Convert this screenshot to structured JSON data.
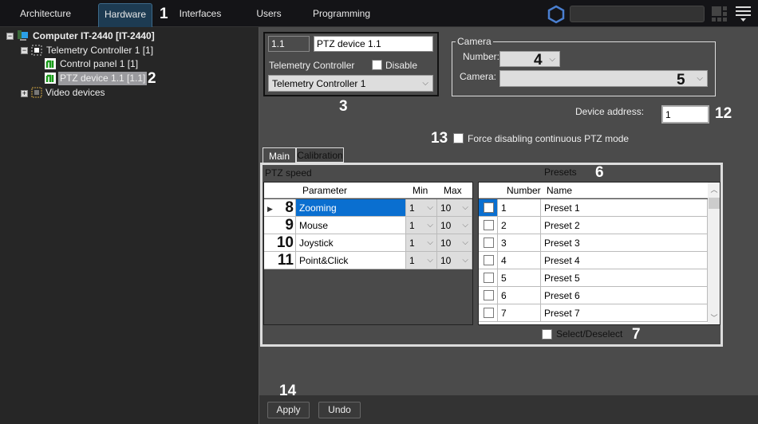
{
  "topbar": {
    "tabs": [
      {
        "label": "Architecture"
      },
      {
        "label": "Hardware",
        "active": true
      },
      {
        "label": "Interfaces"
      },
      {
        "label": "Users"
      },
      {
        "label": "Programming"
      }
    ],
    "search_value": "",
    "accent": "#4a7fd0"
  },
  "tree": {
    "root": "Computer IT-2440 [IT-2440]",
    "controller": "Telemetry Controller 1 [1]",
    "control_panel": "Control panel 1 [1]",
    "ptz_device": "PTZ device 1.1 [1.1]",
    "video_devices": "Video devices"
  },
  "device": {
    "id": "1.1",
    "name": "PTZ device 1.1",
    "controller_label": "Telemetry Controller",
    "disable_label": "Disable",
    "controller_value": "Telemetry Controller 1"
  },
  "camera": {
    "group_label": "Camera",
    "number_label": "Number:",
    "number_value": "",
    "camera_label": "Camera:",
    "camera_value": ""
  },
  "device_address": {
    "label": "Device address:",
    "value": "1"
  },
  "force_disable_label": "Force disabling continuous PTZ mode",
  "tabs": [
    {
      "label": "Main",
      "active": true
    },
    {
      "label": "Calibration"
    }
  ],
  "ptz_speed": {
    "title": "PTZ speed",
    "columns": [
      "Parameter",
      "Min",
      "Max"
    ],
    "rows": [
      {
        "param": "Zooming",
        "min": "1",
        "max": "10",
        "selected": true
      },
      {
        "param": "Mouse",
        "min": "1",
        "max": "10"
      },
      {
        "param": "Joystick",
        "min": "1",
        "max": "10"
      },
      {
        "param": "Point&Click",
        "min": "1",
        "max": "10"
      }
    ]
  },
  "presets": {
    "title": "Presets",
    "columns": [
      "Number",
      "Name"
    ],
    "rows": [
      {
        "number": "1",
        "name": "Preset 1"
      },
      {
        "number": "2",
        "name": "Preset 2"
      },
      {
        "number": "3",
        "name": "Preset 3"
      },
      {
        "number": "4",
        "name": "Preset 4"
      },
      {
        "number": "5",
        "name": "Preset 5"
      },
      {
        "number": "6",
        "name": "Preset 6"
      },
      {
        "number": "7",
        "name": "Preset 7"
      }
    ],
    "select_all_label": "Select/Deselect"
  },
  "footer": {
    "apply_label": "Apply",
    "undo_label": "Undo"
  },
  "callouts": {
    "c1": "1",
    "c2": "2",
    "c3": "3",
    "c4": "4",
    "c5": "5",
    "c6": "6",
    "c7": "7",
    "c8": "8",
    "c9": "9",
    "c10": "10",
    "c11": "11",
    "c12": "12",
    "c13": "13",
    "c14": "14"
  }
}
